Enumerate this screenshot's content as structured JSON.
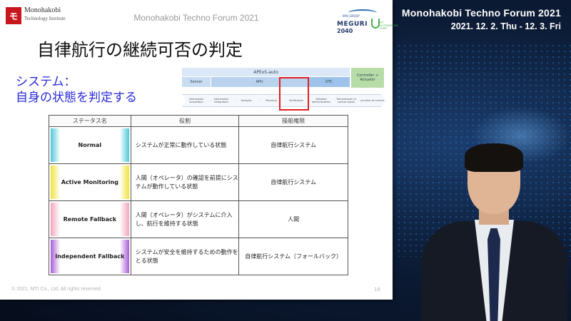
{
  "event": {
    "title": "Monohakobi Techno Forum  2021",
    "dates": "2021. 12. 2. Thu - 12. 3. Fri"
  },
  "slide": {
    "logo_glyph": "モ",
    "logo_name": "Monohakobi",
    "logo_sub": "Technology Institute",
    "forum_title": "Monohakobi Techno Forum 2021",
    "meguri": {
      "group": "NYK GROUP",
      "word": "MEGURI",
      "year": "2040",
      "tag": "FIT AUTONOMOUS SHIPS"
    },
    "title": "自律航行の継続可否の判定",
    "subtitle_line1": "システム：",
    "subtitle_line2": "自身の状態を判定する",
    "architecture": {
      "top_band": "APExS-auto",
      "sensor": "Sensor",
      "apu": "APU",
      "dtc": "DTC",
      "controller": "Controller + Actuator",
      "flow": [
        "Information acquisition",
        "Information integration",
        "Analysis",
        "Planning",
        "Verification",
        "Detailed administration",
        "Transmission of control signal",
        "Execution of control"
      ]
    },
    "table": {
      "headers": [
        "ステータス名",
        "役割",
        "操船権限"
      ],
      "rows": [
        {
          "name": "Normal",
          "role": "システムが正常に動作している状態",
          "authority": "自律航行システム"
        },
        {
          "name": "Active Monitoring",
          "role": "人間（オペレータ）の確認を前提にシステムが動作している状態",
          "authority": "自律航行システム"
        },
        {
          "name": "Remote Fallback",
          "role": "人間（オペレータ）がシステムに介入し、航行を維持する状態",
          "authority": "人間"
        },
        {
          "name": "Independent Fallback",
          "role": "システムが安全を維持するための動作をとる状態",
          "authority": "自律航行システム（フォールバック）"
        }
      ]
    },
    "copyright": "© 2021, MTI Co., Ltd. All rights reserved.",
    "page_number": "18"
  },
  "colors": {
    "normal": "#4fc7d9",
    "active_monitoring": "#f0e33c",
    "remote_fallback": "#f2a7bd",
    "independent_fallback": "#a95ed4",
    "subtitle": "#2b2bd6",
    "highlight": "#e02020"
  }
}
